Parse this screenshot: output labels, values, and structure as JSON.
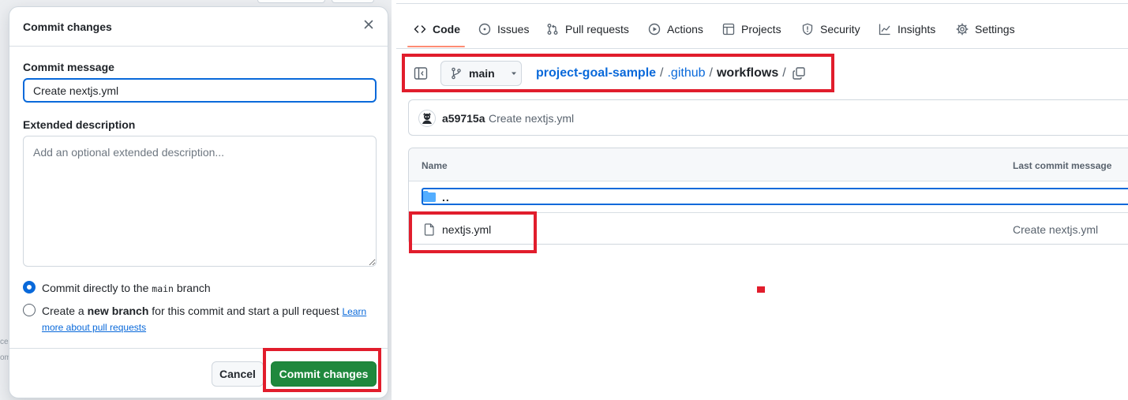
{
  "background_fragments": [
    "ce",
    "om"
  ],
  "dialog": {
    "title": "Commit changes",
    "close_icon": "x-icon",
    "commit_message_label": "Commit message",
    "commit_message_value": "Create nextjs.yml",
    "extended_description_label": "Extended description",
    "extended_description_placeholder": "Add an optional extended description...",
    "options": {
      "direct": {
        "selected": true,
        "text_before": "Commit directly to the ",
        "branch": "main",
        "text_after": " branch"
      },
      "new_branch": {
        "selected": false,
        "text_before": "Create a ",
        "bold": "new branch",
        "text_after": " for this commit and start a pull request ",
        "link_part1": "Learn",
        "link_part2": "more about pull requests"
      }
    },
    "cancel_label": "Cancel",
    "commit_label": "Commit changes",
    "colors": {
      "primary": "#1f883d",
      "focus": "#0969da"
    }
  },
  "repo": {
    "tabs": [
      {
        "label": "Code",
        "icon": "code-icon",
        "selected": true
      },
      {
        "label": "Issues",
        "icon": "issue-opened-icon",
        "selected": false
      },
      {
        "label": "Pull requests",
        "icon": "git-pull-request-icon",
        "selected": false
      },
      {
        "label": "Actions",
        "icon": "play-icon",
        "selected": false
      },
      {
        "label": "Projects",
        "icon": "table-icon",
        "selected": false
      },
      {
        "label": "Security",
        "icon": "shield-icon",
        "selected": false
      },
      {
        "label": "Insights",
        "icon": "graph-icon",
        "selected": false
      },
      {
        "label": "Settings",
        "icon": "gear-icon",
        "selected": false
      }
    ],
    "branch": "main",
    "breadcrumb": {
      "repo": "project-goal-sample",
      "sep1": "/",
      "dir1": ".github",
      "sep2": "/",
      "current": "workflows",
      "sep3": "/"
    },
    "latest_commit": {
      "sha": "a59715a",
      "message": "Create nextjs.yml"
    },
    "files_header": {
      "name": "Name",
      "last_commit": "Last commit message"
    },
    "parent_row": "..",
    "files": [
      {
        "name": "nextjs.yml",
        "icon": "file-icon",
        "last_commit_message": "Create nextjs.yml"
      }
    ]
  },
  "annotation_color": "#e11d2c"
}
